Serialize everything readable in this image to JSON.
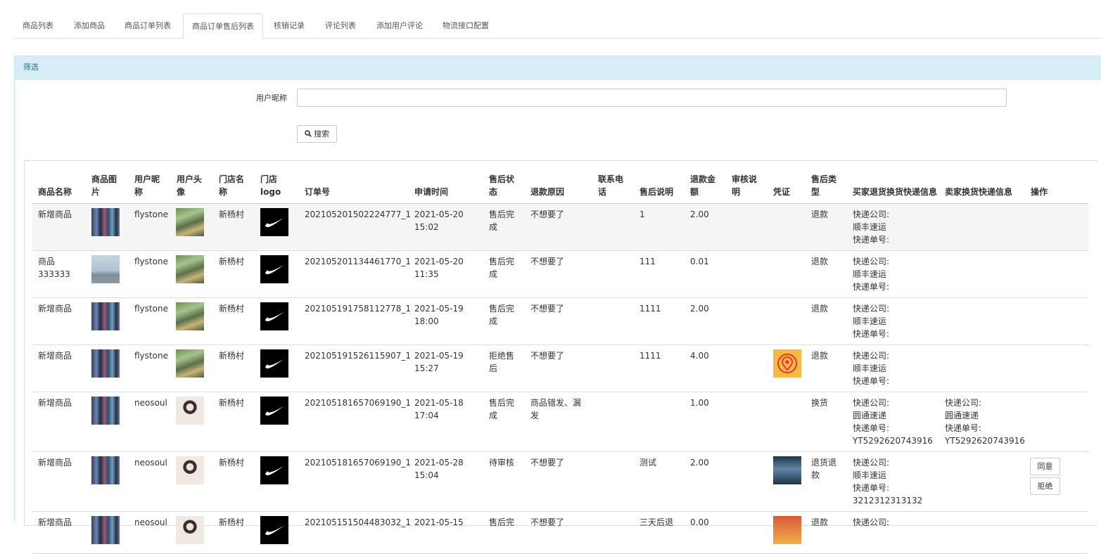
{
  "tabs": [
    "商品列表",
    "添加商品",
    "商品订单列表",
    "商品订单售后列表",
    "核销记录",
    "评论列表",
    "添加用户评论",
    "物流接口配置"
  ],
  "filter": {
    "heading": "筛选",
    "nickname_label": "用户昵称",
    "nickname_value": "",
    "search_label": "搜索"
  },
  "table": {
    "headers": [
      "商品名称",
      "商品图片",
      "用户昵称",
      "用户头像",
      "门店名称",
      "门店logo",
      "订单号",
      "申请时间",
      "售后状态",
      "退款原因",
      "联系电话",
      "售后说明",
      "退款金额",
      "审核说明",
      "凭证",
      "售后类型",
      "买家退货换货快递信息",
      "卖家换货快递信息",
      "操作"
    ],
    "rows": [
      {
        "product": "新增商品",
        "nickname": "flystone",
        "store": "新杨村",
        "order_no": "202105201502224777_1",
        "date": "2021-05-20",
        "time": "15:02",
        "status": "售后完成",
        "reason": "不想要了",
        "phone": "",
        "desc": "1",
        "amount": "2.00",
        "audit": "",
        "type": "退款",
        "buyer_company_label": "快递公司:",
        "buyer_company": "顺丰速运",
        "buyer_no_label": "快递单号:",
        "buyer_no": "",
        "seller_company_label": "",
        "seller_company": "",
        "seller_no_label": "",
        "seller_no": ""
      },
      {
        "product": "商品333333",
        "nickname": "flystone",
        "store": "新杨村",
        "order_no": "202105201134461770_1",
        "date": "2021-05-20",
        "time": "11:35",
        "status": "售后完成",
        "reason": "不想要了",
        "phone": "",
        "desc": "111",
        "amount": "0.01",
        "audit": "",
        "type": "退款",
        "buyer_company_label": "快递公司:",
        "buyer_company": "顺丰速运",
        "buyer_no_label": "快递单号:",
        "buyer_no": "",
        "seller_company_label": "",
        "seller_company": "",
        "seller_no_label": "",
        "seller_no": ""
      },
      {
        "product": "新增商品",
        "nickname": "flystone",
        "store": "新杨村",
        "order_no": "202105191758112778_1",
        "date": "2021-05-19",
        "time": "18:00",
        "status": "售后完成",
        "reason": "不想要了",
        "phone": "",
        "desc": "1111",
        "amount": "2.00",
        "audit": "",
        "type": "退款",
        "buyer_company_label": "快递公司:",
        "buyer_company": "顺丰速运",
        "buyer_no_label": "快递单号:",
        "buyer_no": "",
        "seller_company_label": "",
        "seller_company": "",
        "seller_no_label": "",
        "seller_no": ""
      },
      {
        "product": "新增商品",
        "nickname": "flystone",
        "store": "新杨村",
        "order_no": "202105191526115907_1",
        "date": "2021-05-19",
        "time": "15:27",
        "status": "拒绝售后",
        "reason": "不想要了",
        "phone": "",
        "desc": "1111",
        "amount": "4.00",
        "audit": "",
        "type": "退款",
        "buyer_company_label": "快递公司:",
        "buyer_company": "顺丰速运",
        "buyer_no_label": "快递单号:",
        "buyer_no": "",
        "seller_company_label": "",
        "seller_company": "",
        "seller_no_label": "",
        "seller_no": ""
      },
      {
        "product": "新增商品",
        "nickname": "neosoul",
        "store": "新杨村",
        "order_no": "202105181657069190_1",
        "date": "2021-05-18",
        "time": "17:04",
        "status": "售后完成",
        "reason": "商品错发、漏发",
        "phone": "",
        "desc": "",
        "amount": "1.00",
        "audit": "",
        "type": "换货",
        "buyer_company_label": "快递公司:",
        "buyer_company": "圆通速递",
        "buyer_no_label": "快递单号:",
        "buyer_no": "YT5292620743916",
        "seller_company_label": "快递公司:",
        "seller_company": "圆通速递",
        "seller_no_label": "快递单号:",
        "seller_no": "YT5292620743916"
      },
      {
        "product": "新增商品",
        "nickname": "neosoul",
        "store": "新杨村",
        "order_no": "202105181657069190_1",
        "date": "2021-05-28",
        "time": "15:04",
        "status": "待审核",
        "reason": "不想要了",
        "phone": "",
        "desc": "测试",
        "amount": "2.00",
        "audit": "",
        "type": "退货退款",
        "buyer_company_label": "快递公司:",
        "buyer_company": "顺丰速运",
        "buyer_no_label": "快递单号:",
        "buyer_no": "3212312313132",
        "seller_company_label": "",
        "seller_company": "",
        "seller_no_label": "",
        "seller_no": "",
        "actions": [
          "同意",
          "拒绝"
        ]
      },
      {
        "product": "新增商品",
        "nickname": "neosoul",
        "store": "新杨村",
        "order_no": "202105151504483032_1",
        "date": "2021-05-15",
        "time": "",
        "status": "售后完",
        "reason": "不想要了",
        "phone": "",
        "desc": "三天后退",
        "amount": "0.00",
        "audit": "",
        "type": "退款",
        "buyer_company_label": "快递公司:",
        "buyer_company": "",
        "buyer_no_label": "",
        "buyer_no": "",
        "seller_company_label": "",
        "seller_company": "",
        "seller_no_label": "",
        "seller_no": ""
      }
    ]
  },
  "colors": {
    "panel_heading_bg": "#d9edf7",
    "panel_heading_text": "#31708f",
    "striped_row": "#f5f5f5",
    "voucher_icon_bg": "#f7b944",
    "voucher_icon_red": "#e53935"
  },
  "icons": {
    "search": "magnifier-icon",
    "store_logo": "nike-swoosh-icon",
    "voucher": "location-pin-icon"
  }
}
